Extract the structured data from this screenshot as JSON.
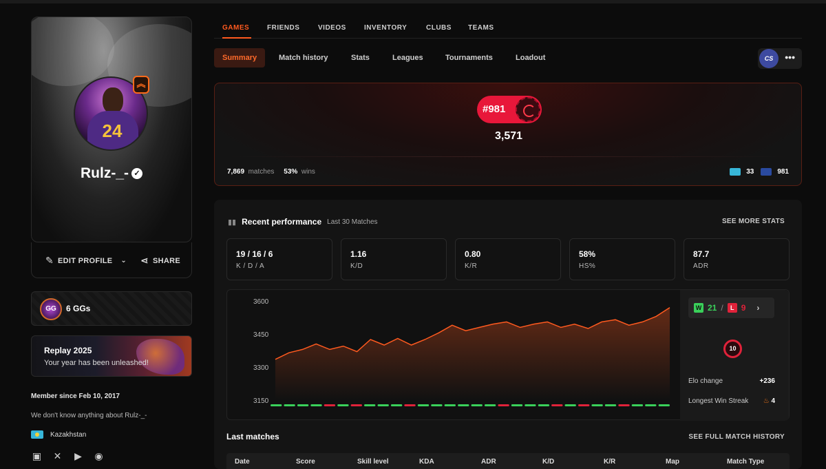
{
  "profile": {
    "username": "Rulz-_-",
    "avatar_number": "24",
    "edit_label": "EDIT PROFILE",
    "share_label": "SHARE",
    "gg_label": "6 GGs",
    "gg_icon_text": "GG",
    "replay_title": "Replay 2025",
    "replay_sub": "Your year has been unleashed!",
    "member_since": "Member since Feb 10, 2017",
    "about": "We don't know anything about Rulz-_-",
    "country": "Kazakhstan"
  },
  "nav": {
    "tabs": [
      {
        "label": "GAMES"
      },
      {
        "label": "FRIENDS"
      },
      {
        "label": "VIDEOS"
      },
      {
        "label": "INVENTORY"
      },
      {
        "label": "CLUBS"
      },
      {
        "label": "TEAMS"
      }
    ],
    "active": "GAMES"
  },
  "subnav": {
    "items": [
      {
        "label": "Summary"
      },
      {
        "label": "Match history"
      },
      {
        "label": "Stats"
      },
      {
        "label": "Leagues"
      },
      {
        "label": "Tournaments"
      },
      {
        "label": "Loadout"
      }
    ],
    "active": "Summary",
    "game_logo": "CS"
  },
  "elo_card": {
    "rank": "#981",
    "elo": "3,571",
    "matches_count": "7,869",
    "matches_label": "matches",
    "win_pct": "53%",
    "win_label": "wins",
    "country_rank": "33",
    "region_rank": "981"
  },
  "performance": {
    "title": "Recent performance",
    "subtitle": "Last 30 Matches",
    "see_more": "SEE MORE STATS",
    "stats": [
      {
        "value": "19 / 16 / 6",
        "label": "K / D / A"
      },
      {
        "value": "1.16",
        "label": "K/D"
      },
      {
        "value": "0.80",
        "label": "K/R"
      },
      {
        "value": "58%",
        "label": "HS%"
      },
      {
        "value": "87.7",
        "label": "ADR"
      }
    ],
    "wins": "21",
    "losses": "9",
    "level": "10",
    "elo_change_label": "Elo change",
    "elo_change": "+236",
    "streak_label": "Longest Win Streak",
    "streak": "4"
  },
  "chart_data": {
    "type": "area",
    "title": "",
    "xlabel": "",
    "ylabel": "",
    "yticks": [
      "3600",
      "3450",
      "3300",
      "3150"
    ],
    "ylim": [
      3150,
      3600
    ],
    "series": [
      {
        "values": [
          3335,
          3365,
          3380,
          3405,
          3380,
          3395,
          3370,
          3425,
          3400,
          3430,
          3400,
          3425,
          3455,
          3490,
          3465,
          3480,
          3495,
          3505,
          3480,
          3495,
          3505,
          3480,
          3495,
          3475,
          3505,
          3515,
          3490,
          3505,
          3530,
          3570
        ]
      }
    ],
    "results": [
      "W",
      "W",
      "W",
      "W",
      "L",
      "W",
      "L",
      "W",
      "W",
      "W",
      "L",
      "W",
      "W",
      "W",
      "W",
      "W",
      "W",
      "L",
      "W",
      "W",
      "W",
      "L",
      "W",
      "L",
      "W",
      "W",
      "L",
      "W",
      "W",
      "W"
    ],
    "colors": {
      "line": "#ff5a1f",
      "win": "#3ad05a",
      "loss": "#e0223a"
    }
  },
  "last_matches": {
    "title": "Last matches",
    "see_full": "SEE FULL MATCH HISTORY",
    "columns": [
      "Date",
      "Score",
      "Skill level",
      "KDA",
      "ADR",
      "K/D",
      "K/R",
      "Map",
      "Match Type"
    ]
  }
}
